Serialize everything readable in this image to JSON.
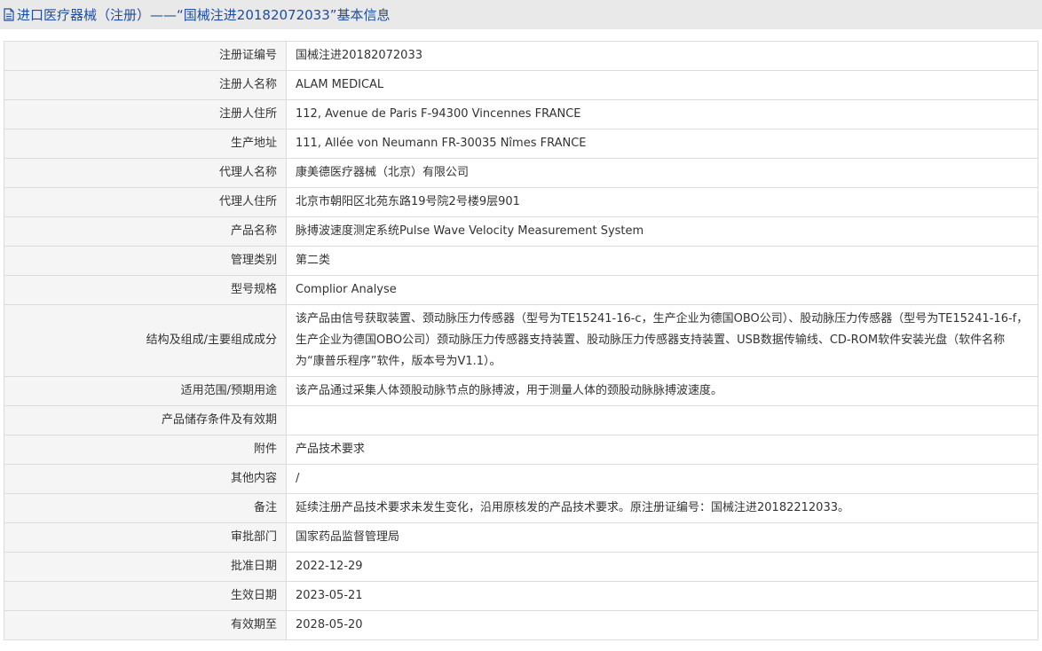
{
  "header": {
    "title": "进口医疗器械（注册）——“国械注进20182072033”基本信息",
    "icon": "document-icon"
  },
  "fields": [
    {
      "label": "注册证编号",
      "value": "国械注进20182072033"
    },
    {
      "label": "注册人名称",
      "value": "ALAM MEDICAL"
    },
    {
      "label": "注册人住所",
      "value": "112, Avenue de Paris F-94300 Vincennes FRANCE"
    },
    {
      "label": "生产地址",
      "value": "111, Allée von Neumann FR-30035 Nîmes FRANCE"
    },
    {
      "label": "代理人名称",
      "value": "康美德医疗器械（北京）有限公司"
    },
    {
      "label": "代理人住所",
      "value": "北京市朝阳区北苑东路19号院2号楼9层901"
    },
    {
      "label": "产品名称",
      "value": "脉搏波速度测定系统Pulse Wave Velocity Measurement System"
    },
    {
      "label": "管理类别",
      "value": "第二类"
    },
    {
      "label": "型号规格",
      "value": "Complior Analyse"
    },
    {
      "label": "结构及组成/主要组成成分",
      "value": "该产品由信号获取装置、颈动脉压力传感器（型号为TE15241-16-c，生产企业为德国OBO公司）、股动脉压力传感器（型号为TE15241-16-f，生产企业为德国OBO公司）颈动脉压力传感器支持装置、股动脉压力传感器支持装置、USB数据传输线、CD-ROM软件安装光盘（软件名称为“康普乐程序”软件，版本号为V1.1）。"
    },
    {
      "label": "适用范围/预期用途",
      "value": "该产品通过采集人体颈股动脉节点的脉搏波，用于测量人体的颈股动脉脉搏波速度。"
    },
    {
      "label": "产品储存条件及有效期",
      "value": ""
    },
    {
      "label": "附件",
      "value": "产品技术要求"
    },
    {
      "label": "其他内容",
      "value": "/"
    },
    {
      "label": "备注",
      "value": "延续注册产品技术要求未发生变化，沿用原核发的产品技术要求。原注册证编号：国械注进20182212033。"
    },
    {
      "label": "审批部门",
      "value": "国家药品监督管理局"
    },
    {
      "label": "批准日期",
      "value": "2022-12-29"
    },
    {
      "label": "生效日期",
      "value": "2023-05-21"
    },
    {
      "label": "有效期至",
      "value": "2028-05-20"
    }
  ]
}
